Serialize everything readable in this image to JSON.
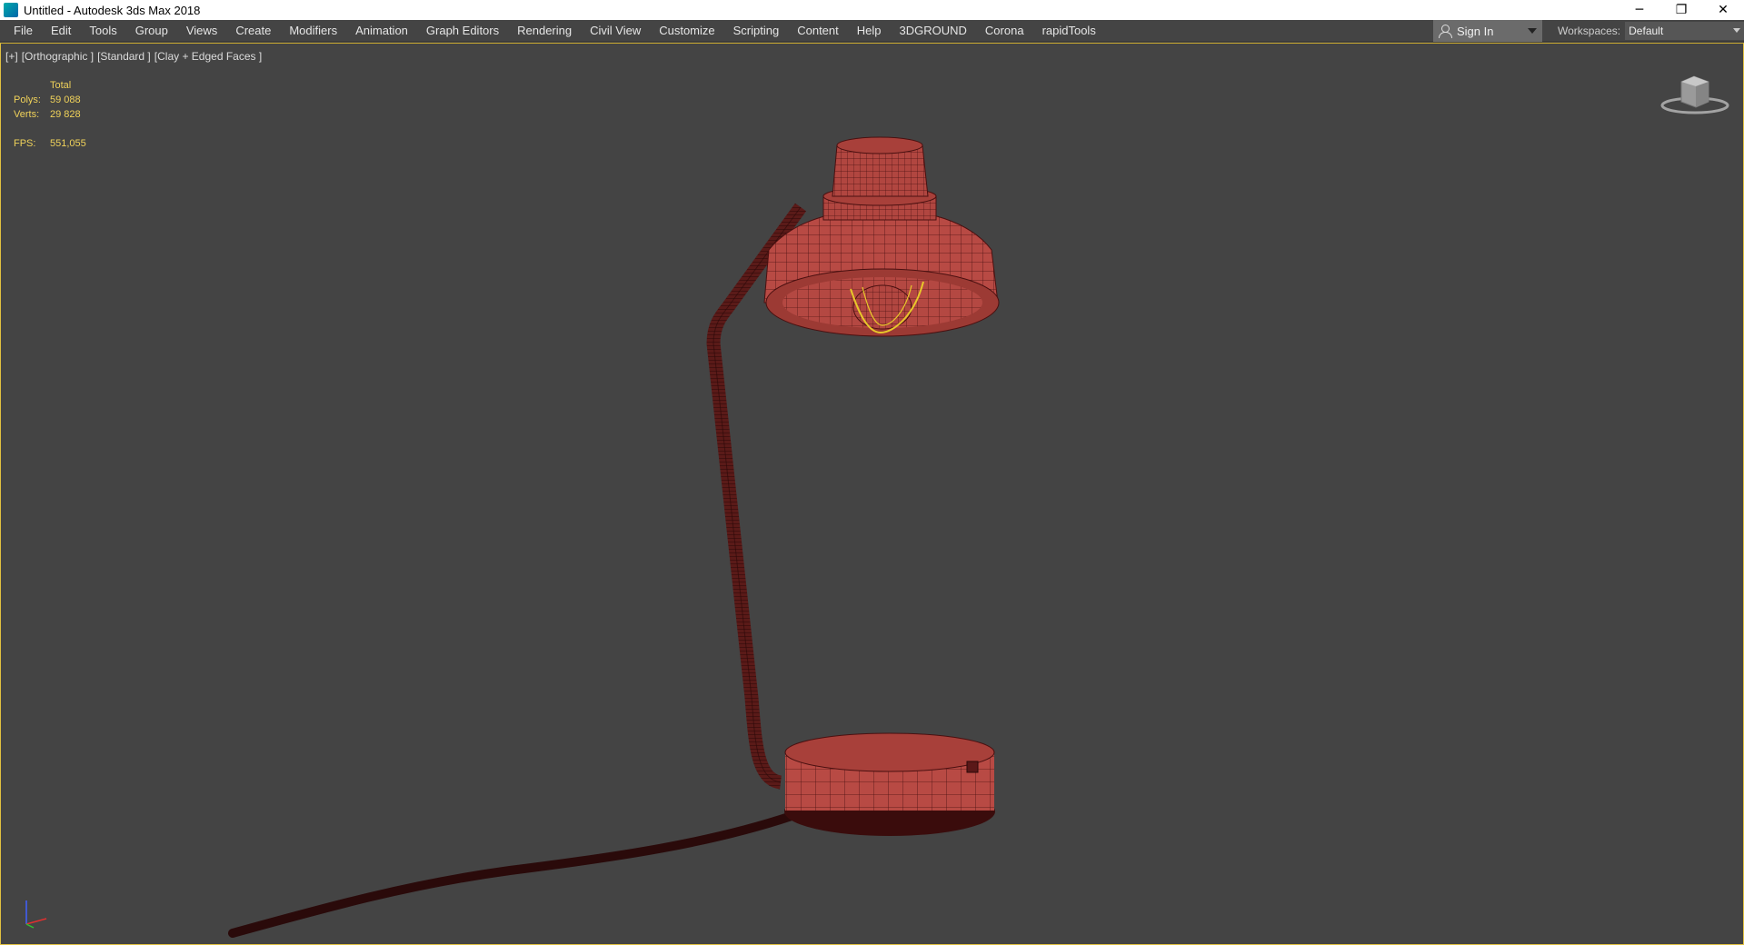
{
  "window": {
    "title": "Untitled - Autodesk 3ds Max 2018",
    "controls": {
      "minimize": "─",
      "restore": "❐",
      "close": "✕"
    }
  },
  "menubar": {
    "items": [
      "File",
      "Edit",
      "Tools",
      "Group",
      "Views",
      "Create",
      "Modifiers",
      "Animation",
      "Graph Editors",
      "Rendering",
      "Civil View",
      "Customize",
      "Scripting",
      "Content",
      "Help",
      "3DGROUND",
      "Corona",
      "rapidTools"
    ],
    "sign_in": "Sign In",
    "workspaces_label": "Workspaces:",
    "workspace_value": "Default"
  },
  "viewport": {
    "labels": [
      "[+]",
      "[Orthographic ]",
      "[Standard ]",
      "[Clay + Edged Faces ]"
    ],
    "stats": {
      "header": "Total",
      "polys_label": "Polys:",
      "polys": "59 088",
      "verts_label": "Verts:",
      "verts": "29 828",
      "fps_label": "FPS:",
      "fps": "551,055"
    },
    "colors": {
      "background": "#444444",
      "stats_text": "#f0d25a",
      "model": "#b84a44",
      "wire": "#4a1010",
      "selection": "#e8c82a"
    },
    "icons": [
      "viewcube-icon",
      "axis-tripod-icon"
    ]
  }
}
